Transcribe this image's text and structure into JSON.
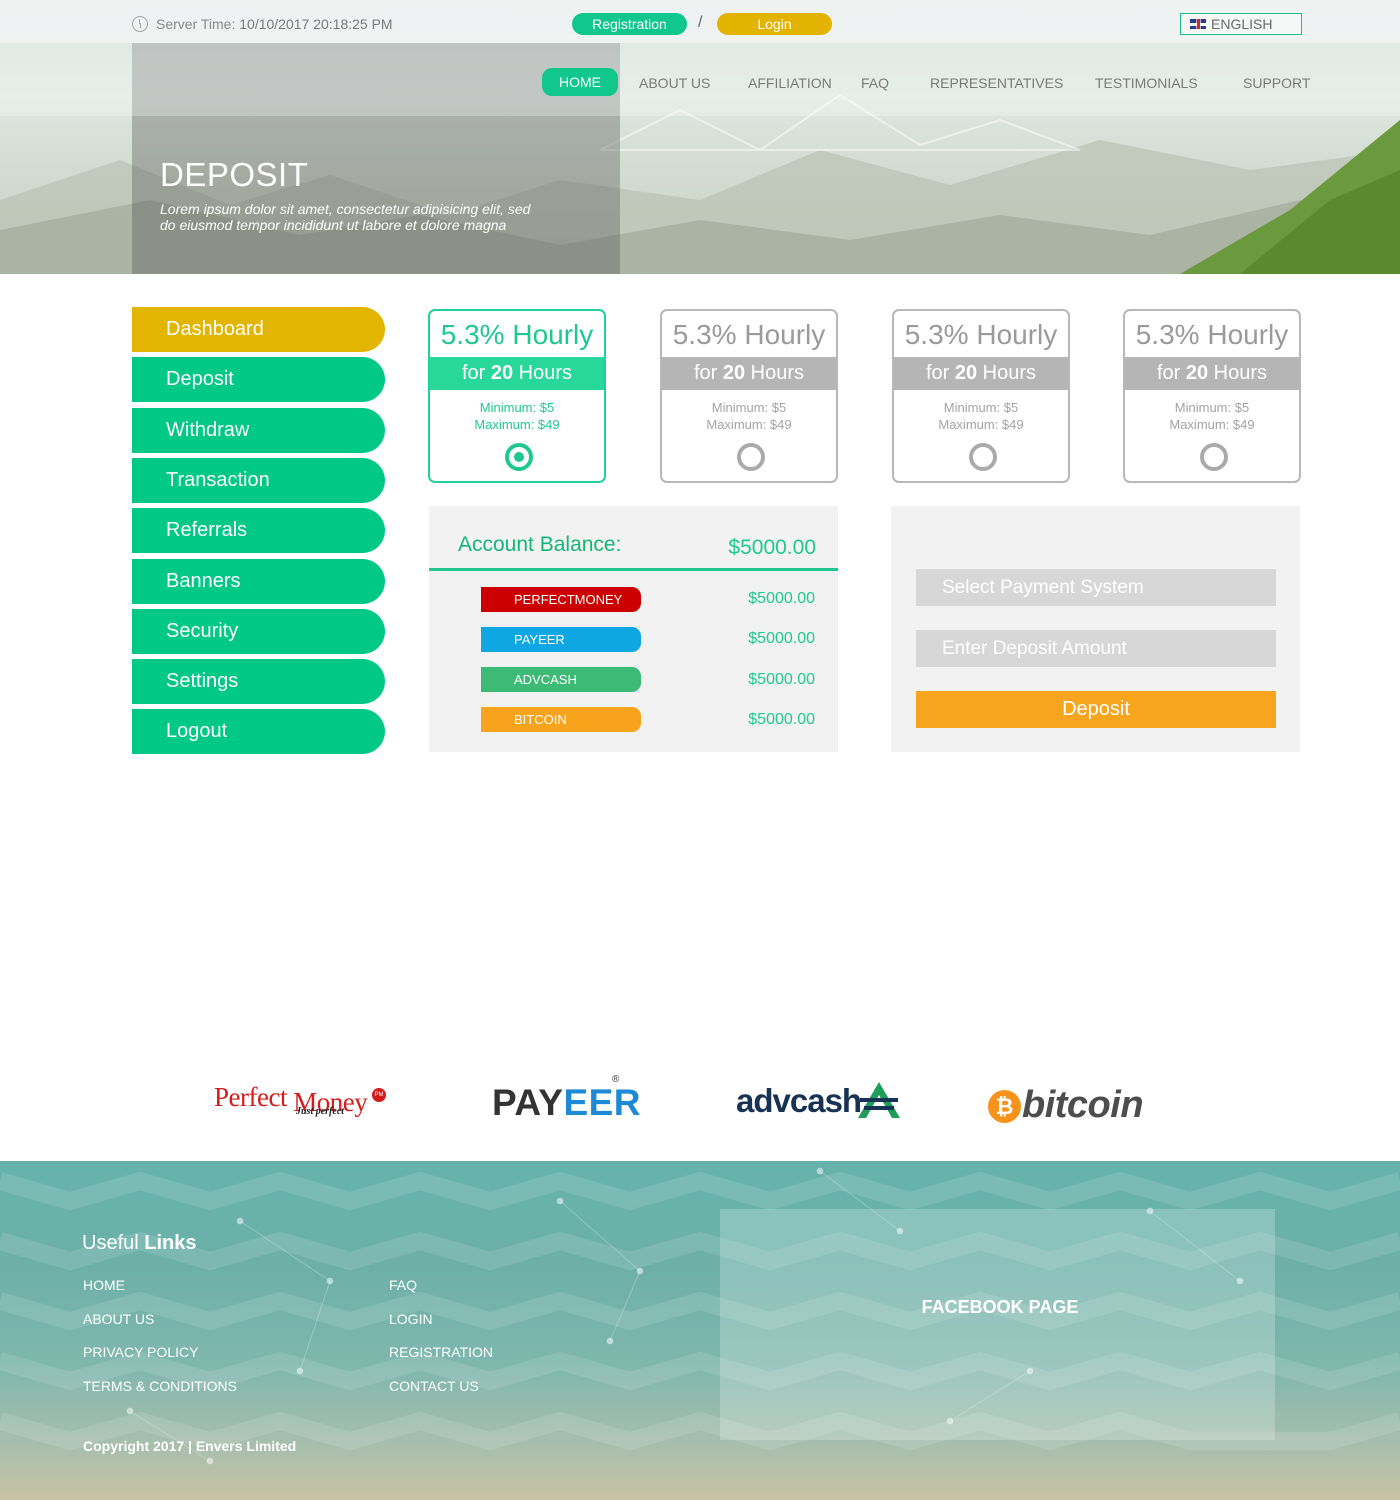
{
  "topbar": {
    "server_time_label": "Server Time:",
    "server_time_value": "10/10/2017 20:18:25 PM",
    "registration_label": "Registration",
    "separator": "/",
    "login_label": "Login",
    "language": "ENGLISH"
  },
  "nav": {
    "items": [
      "HOME",
      "ABOUT US",
      "AFFILIATION",
      "FAQ",
      "REPRESENTATIVES",
      "TESTIMONIALS",
      "SUPPORT"
    ],
    "active": "HOME"
  },
  "hero": {
    "title": "DEPOSIT",
    "subtitle": "Lorem ipsum dolor sit amet, consectetur adipisicing elit, sed do eiusmod tempor incididunt ut labore et dolore magna"
  },
  "sidebar": {
    "items": [
      "Dashboard",
      "Deposit",
      "Withdraw",
      "Transaction",
      "Referrals",
      "Banners",
      "Security",
      "Settings",
      "Logout"
    ],
    "active": "Dashboard"
  },
  "plans": [
    {
      "rate": "5.3%",
      "period": "Hourly",
      "for_prefix": "for",
      "duration": "20",
      "duration_unit": "Hours",
      "minimum": "Minimum: $5",
      "maximum": "Maximum: $49",
      "selected": true
    },
    {
      "rate": "5.3%",
      "period": "Hourly",
      "for_prefix": "for",
      "duration": "20",
      "duration_unit": "Hours",
      "minimum": "Minimum: $5",
      "maximum": "Maximum: $49",
      "selected": false
    },
    {
      "rate": "5.3%",
      "period": "Hourly",
      "for_prefix": "for",
      "duration": "20",
      "duration_unit": "Hours",
      "minimum": "Minimum: $5",
      "maximum": "Maximum: $49",
      "selected": false
    },
    {
      "rate": "5.3%",
      "period": "Hourly",
      "for_prefix": "for",
      "duration": "20",
      "duration_unit": "Hours",
      "minimum": "Minimum: $5",
      "maximum": "Maximum: $49",
      "selected": false
    }
  ],
  "balance": {
    "label": "Account Balance:",
    "total": "$5000.00",
    "systems": [
      {
        "name": "PERFECTMONEY",
        "amount": "$5000.00",
        "color": "#cc0000"
      },
      {
        "name": "PAYEER",
        "amount": "$5000.00",
        "color": "#0ea6e3"
      },
      {
        "name": "ADVCASH",
        "amount": "$5000.00",
        "color": "#3dba75"
      },
      {
        "name": "BITCOIN",
        "amount": "$5000.00",
        "color": "#f7a41c"
      }
    ]
  },
  "deposit_form": {
    "payment_placeholder": "Select Payment System",
    "amount_placeholder": "Enter Deposit Amount",
    "submit_label": "Deposit"
  },
  "partners": {
    "perfect_money": {
      "word1": "Perfect",
      "word2": "Money",
      "tagline": "Just perfect",
      "badge": "PM"
    },
    "payeer": {
      "part1": "PAY",
      "part2": "EER",
      "reg": "®"
    },
    "advcash": {
      "text": "advcash"
    },
    "bitcoin": {
      "symbol": "₿",
      "text": "bitcoin"
    }
  },
  "footer": {
    "title_light": "Useful",
    "title_bold": "Links",
    "links_col1": [
      "HOME",
      "ABOUT US",
      "PRIVACY POLICY",
      "TERMS & CONDITIONS"
    ],
    "links_col2": [
      "FAQ",
      "LOGIN",
      "REGISTRATION",
      "CONTACT US"
    ],
    "copyright": "Copyright 2017 | Envers Limited",
    "facebook_title": "FACEBOOK PAGE"
  },
  "colors": {
    "accent_green": "#00c885",
    "accent_yellow": "#e2b500",
    "deposit_orange": "#f6a51c",
    "plan_selected": "#1fc98e",
    "plan_inactive": "#b5b5b5"
  }
}
